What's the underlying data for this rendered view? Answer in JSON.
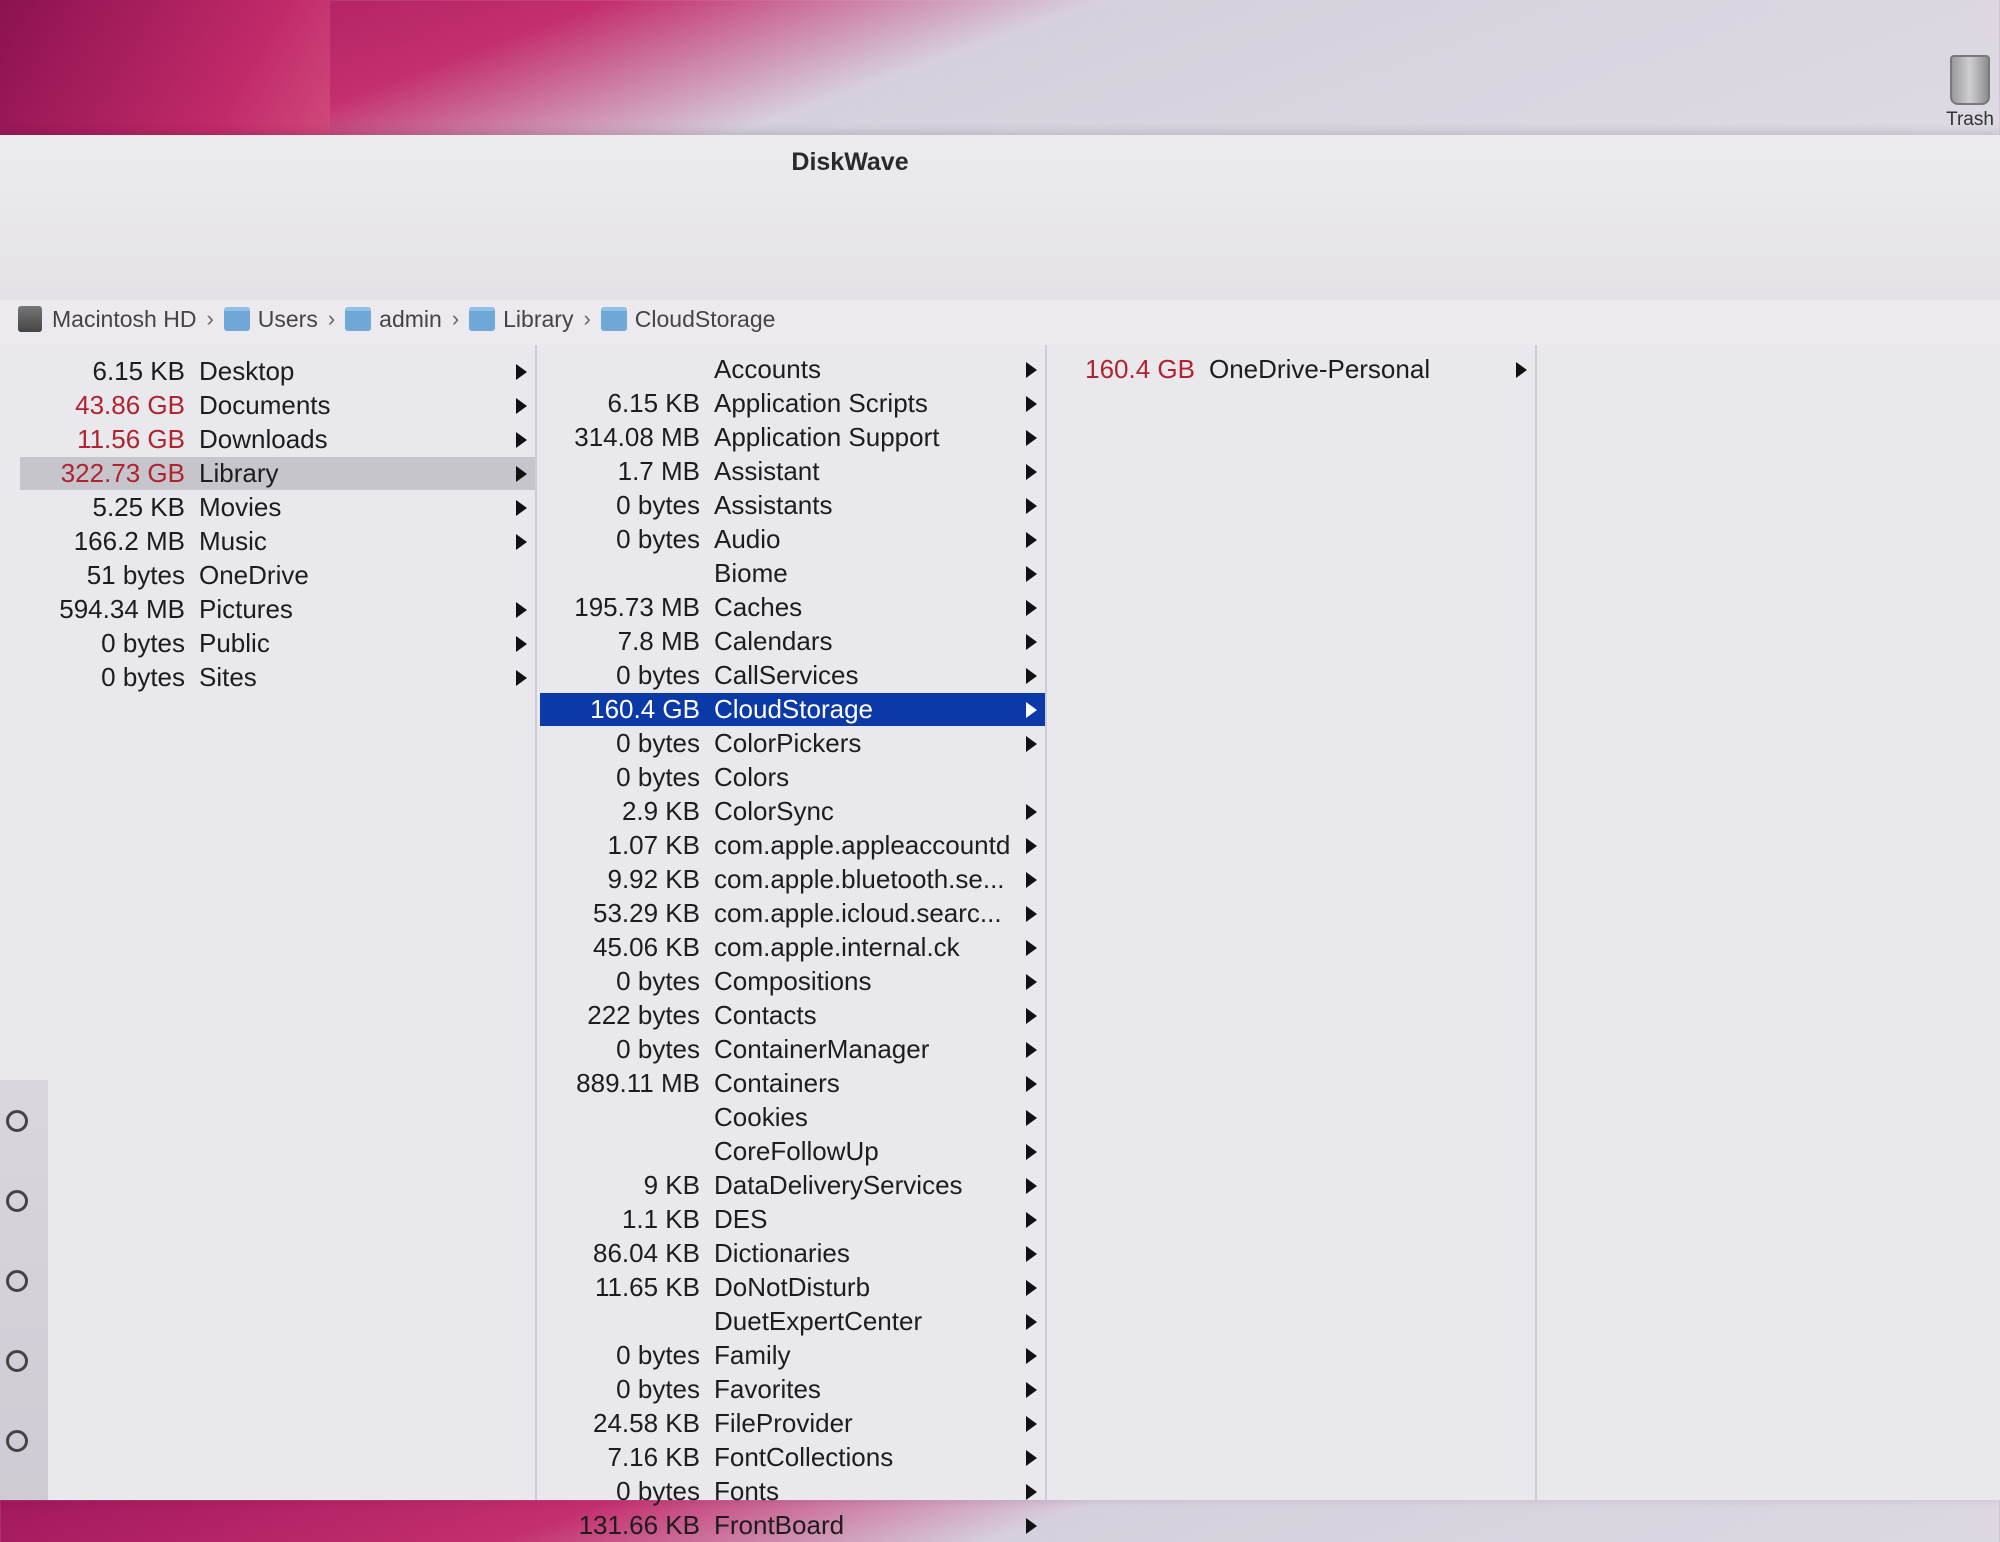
{
  "window": {
    "title": "DiskWave"
  },
  "desktop": {
    "trash_label": "Trash"
  },
  "pathbar": {
    "items": [
      {
        "label": "Macintosh HD",
        "icon": "hard-drive-icon"
      },
      {
        "label": "Users",
        "icon": "folder-icon"
      },
      {
        "label": "admin",
        "icon": "folder-icon"
      },
      {
        "label": "Library",
        "icon": "folder-icon"
      },
      {
        "label": "CloudStorage",
        "icon": "folder-icon"
      }
    ]
  },
  "columns": [
    {
      "rows": [
        {
          "size": "6.15 KB",
          "name": "Desktop",
          "arrow": true
        },
        {
          "size": "43.86 GB",
          "name": "Documents",
          "arrow": true,
          "red": true
        },
        {
          "size": "11.56 GB",
          "name": "Downloads",
          "arrow": true,
          "red": true
        },
        {
          "size": "322.73 GB",
          "name": "Library",
          "arrow": true,
          "red": true,
          "selected": "gray"
        },
        {
          "size": "5.25 KB",
          "name": "Movies",
          "arrow": true
        },
        {
          "size": "166.2 MB",
          "name": "Music",
          "arrow": true
        },
        {
          "size": "51 bytes",
          "name": "OneDrive",
          "arrow": false
        },
        {
          "size": "594.34 MB",
          "name": "Pictures",
          "arrow": true
        },
        {
          "size": "0 bytes",
          "name": "Public",
          "arrow": true
        },
        {
          "size": "0 bytes",
          "name": "Sites",
          "arrow": true
        }
      ]
    },
    {
      "rows": [
        {
          "size": "",
          "name": "Accounts",
          "arrow": true
        },
        {
          "size": "6.15 KB",
          "name": "Application Scripts",
          "arrow": true
        },
        {
          "size": "314.08 MB",
          "name": "Application Support",
          "arrow": true
        },
        {
          "size": "1.7 MB",
          "name": "Assistant",
          "arrow": true
        },
        {
          "size": "0 bytes",
          "name": "Assistants",
          "arrow": true
        },
        {
          "size": "0 bytes",
          "name": "Audio",
          "arrow": true
        },
        {
          "size": "",
          "name": "Biome",
          "arrow": true
        },
        {
          "size": "195.73 MB",
          "name": "Caches",
          "arrow": true
        },
        {
          "size": "7.8 MB",
          "name": "Calendars",
          "arrow": true
        },
        {
          "size": "0 bytes",
          "name": "CallServices",
          "arrow": true
        },
        {
          "size": "160.4 GB",
          "name": "CloudStorage",
          "arrow": true,
          "selected": "blue"
        },
        {
          "size": "0 bytes",
          "name": "ColorPickers",
          "arrow": true
        },
        {
          "size": "0 bytes",
          "name": "Colors",
          "arrow": false
        },
        {
          "size": "2.9 KB",
          "name": "ColorSync",
          "arrow": true
        },
        {
          "size": "1.07 KB",
          "name": "com.apple.appleaccountd",
          "arrow": true
        },
        {
          "size": "9.92 KB",
          "name": "com.apple.bluetooth.se...",
          "arrow": true
        },
        {
          "size": "53.29 KB",
          "name": "com.apple.icloud.searc...",
          "arrow": true
        },
        {
          "size": "45.06 KB",
          "name": "com.apple.internal.ck",
          "arrow": true
        },
        {
          "size": "0 bytes",
          "name": "Compositions",
          "arrow": true
        },
        {
          "size": "222 bytes",
          "name": "Contacts",
          "arrow": true
        },
        {
          "size": "0 bytes",
          "name": "ContainerManager",
          "arrow": true
        },
        {
          "size": "889.11 MB",
          "name": "Containers",
          "arrow": true
        },
        {
          "size": "",
          "name": "Cookies",
          "arrow": true
        },
        {
          "size": "",
          "name": "CoreFollowUp",
          "arrow": true
        },
        {
          "size": "9 KB",
          "name": "DataDeliveryServices",
          "arrow": true
        },
        {
          "size": "1.1 KB",
          "name": "DES",
          "arrow": true
        },
        {
          "size": "86.04 KB",
          "name": "Dictionaries",
          "arrow": true
        },
        {
          "size": "11.65 KB",
          "name": "DoNotDisturb",
          "arrow": true
        },
        {
          "size": "",
          "name": "DuetExpertCenter",
          "arrow": true
        },
        {
          "size": "0 bytes",
          "name": "Family",
          "arrow": true
        },
        {
          "size": "0 bytes",
          "name": "Favorites",
          "arrow": true
        },
        {
          "size": "24.58 KB",
          "name": "FileProvider",
          "arrow": true
        },
        {
          "size": "7.16 KB",
          "name": "FontCollections",
          "arrow": true
        },
        {
          "size": "0 bytes",
          "name": "Fonts",
          "arrow": true
        },
        {
          "size": "131.66 KB",
          "name": "FrontBoard",
          "arrow": true
        }
      ]
    },
    {
      "rows": [
        {
          "size": "160.4 GB",
          "name": "OneDrive-Personal",
          "arrow": true,
          "red": true
        }
      ]
    },
    {
      "rows": []
    }
  ]
}
